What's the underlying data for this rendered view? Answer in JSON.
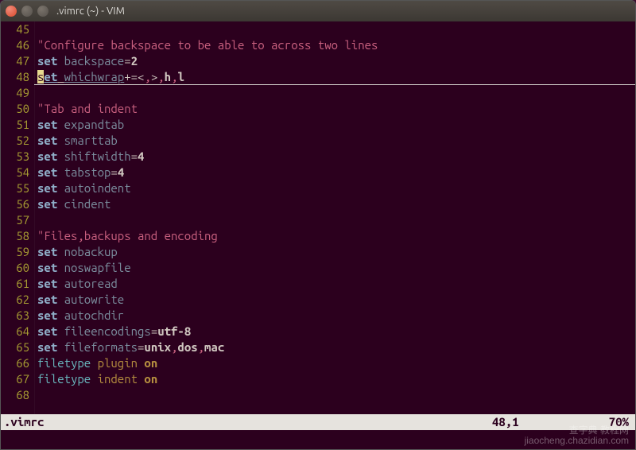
{
  "window": {
    "title": ".vimrc (~) - VIM"
  },
  "gutter": {
    "lines": [
      "45",
      "46",
      "47",
      "48",
      "49",
      "50",
      "51",
      "52",
      "53",
      "54",
      "55",
      "56",
      "57",
      "58",
      "59",
      "60",
      "61",
      "62",
      "63",
      "64",
      "65",
      "66",
      "67",
      "68"
    ]
  },
  "code": {
    "rows": [
      [],
      [
        {
          "t": "\"Configure backspace to be able to across two lines",
          "c": "str"
        }
      ],
      [
        {
          "t": "set",
          "c": "kw-set"
        },
        {
          "t": " "
        },
        {
          "t": "backspace",
          "c": "opt"
        },
        {
          "t": "=",
          "c": "op"
        },
        {
          "t": "2",
          "c": "num"
        }
      ],
      [
        {
          "t": "s",
          "c": "cursor"
        },
        {
          "t": "et",
          "c": "kw-set cursor-word"
        },
        {
          "t": " ",
          "c": "cursor-word"
        },
        {
          "t": "whichwrap",
          "c": "opt cursor-word"
        },
        {
          "t": "+=<",
          "c": "op"
        },
        {
          "t": ",",
          "c": "str"
        },
        {
          "t": ">",
          "c": "op"
        },
        {
          "t": ",",
          "c": "str"
        },
        {
          "t": "h",
          "c": "num"
        },
        {
          "t": ",",
          "c": "str"
        },
        {
          "t": "l",
          "c": "num"
        }
      ],
      [],
      [
        {
          "t": "\"Tab and indent",
          "c": "str"
        }
      ],
      [
        {
          "t": "set",
          "c": "kw-set"
        },
        {
          "t": " "
        },
        {
          "t": "expandtab",
          "c": "opt"
        }
      ],
      [
        {
          "t": "set",
          "c": "kw-set"
        },
        {
          "t": " "
        },
        {
          "t": "smarttab",
          "c": "opt"
        }
      ],
      [
        {
          "t": "set",
          "c": "kw-set"
        },
        {
          "t": " "
        },
        {
          "t": "shiftwidth",
          "c": "opt"
        },
        {
          "t": "=",
          "c": "op"
        },
        {
          "t": "4",
          "c": "num"
        }
      ],
      [
        {
          "t": "set",
          "c": "kw-set"
        },
        {
          "t": " "
        },
        {
          "t": "tabstop",
          "c": "opt"
        },
        {
          "t": "=",
          "c": "op"
        },
        {
          "t": "4",
          "c": "num"
        }
      ],
      [
        {
          "t": "set",
          "c": "kw-set"
        },
        {
          "t": " "
        },
        {
          "t": "autoindent",
          "c": "opt"
        }
      ],
      [
        {
          "t": "set",
          "c": "kw-set"
        },
        {
          "t": " "
        },
        {
          "t": "cindent",
          "c": "opt"
        }
      ],
      [],
      [
        {
          "t": "\"Files,backups and encoding",
          "c": "str"
        }
      ],
      [
        {
          "t": "set",
          "c": "kw-set"
        },
        {
          "t": " "
        },
        {
          "t": "nobackup",
          "c": "opt"
        }
      ],
      [
        {
          "t": "set",
          "c": "kw-set"
        },
        {
          "t": " "
        },
        {
          "t": "noswapfile",
          "c": "opt"
        }
      ],
      [
        {
          "t": "set",
          "c": "kw-set"
        },
        {
          "t": " "
        },
        {
          "t": "autoread",
          "c": "opt"
        }
      ],
      [
        {
          "t": "set",
          "c": "kw-set"
        },
        {
          "t": " "
        },
        {
          "t": "autowrite",
          "c": "opt"
        }
      ],
      [
        {
          "t": "set",
          "c": "kw-set"
        },
        {
          "t": " "
        },
        {
          "t": "autochdir",
          "c": "opt"
        }
      ],
      [
        {
          "t": "set",
          "c": "kw-set"
        },
        {
          "t": " "
        },
        {
          "t": "fileencodings",
          "c": "opt"
        },
        {
          "t": "=",
          "c": "op"
        },
        {
          "t": "utf-8",
          "c": "num"
        }
      ],
      [
        {
          "t": "set",
          "c": "kw-set"
        },
        {
          "t": " "
        },
        {
          "t": "fileformats",
          "c": "opt"
        },
        {
          "t": "=",
          "c": "op"
        },
        {
          "t": "unix",
          "c": "num"
        },
        {
          "t": ",",
          "c": "str"
        },
        {
          "t": "dos",
          "c": "num"
        },
        {
          "t": ",",
          "c": "str"
        },
        {
          "t": "mac",
          "c": "num"
        }
      ],
      [
        {
          "t": "filetype",
          "c": "ident"
        },
        {
          "t": " "
        },
        {
          "t": "plugin",
          "c": "ftcmd"
        },
        {
          "t": " "
        },
        {
          "t": "on",
          "c": "onkw"
        }
      ],
      [
        {
          "t": "filetype",
          "c": "ident"
        },
        {
          "t": " "
        },
        {
          "t": "indent",
          "c": "ftcmd"
        },
        {
          "t": " "
        },
        {
          "t": "on",
          "c": "onkw"
        }
      ],
      []
    ]
  },
  "statusbar": {
    "file": ".vimrc",
    "position": "48,1",
    "percent": "70%"
  },
  "watermark": {
    "line1": "查字典 教程网",
    "line2": "jiaocheng.chazidian.com"
  }
}
